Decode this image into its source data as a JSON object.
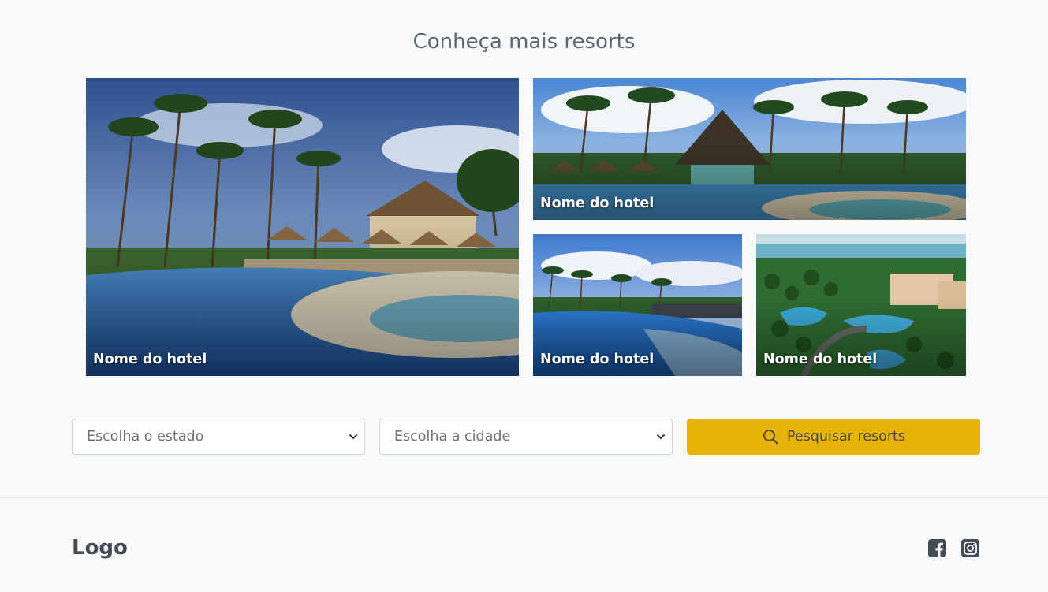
{
  "section": {
    "title": "Conheça mais resorts"
  },
  "hotels": [
    {
      "name": "Nome do hotel"
    },
    {
      "name": "Nome do hotel"
    },
    {
      "name": "Nome do hotel"
    },
    {
      "name": "Nome do hotel"
    }
  ],
  "search": {
    "state_placeholder": "Escolha o estado",
    "city_placeholder": "Escolha a cidade",
    "button_label": "Pesquisar resorts"
  },
  "footer": {
    "logo": "Logo",
    "icons": [
      "facebook-icon",
      "instagram-icon"
    ]
  },
  "colors": {
    "accent": "#e8b309",
    "background": "#f8f9fb",
    "title": "#5f6670"
  }
}
